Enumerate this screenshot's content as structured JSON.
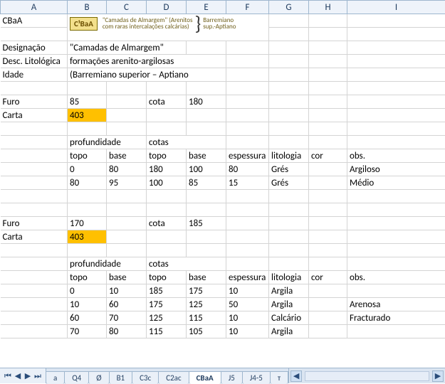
{
  "columns": [
    "A",
    "B",
    "C",
    "D",
    "E",
    "F",
    "G",
    "H",
    "I"
  ],
  "header": {
    "code": "CBaA",
    "legend_code": "C¹BaA",
    "legend_line1": "\"Camadas de Almargem\" (Arenitos",
    "legend_line2": "com raras intercalações calcárias)",
    "legend_age1": "Barremiano",
    "legend_age2": "sup.-Aptiano"
  },
  "labels": {
    "designacao": "Designação",
    "desc_lit": "Desc. Litológica",
    "idade": "Idade",
    "furo": "Furo",
    "carta": "Carta",
    "cota": "cota",
    "profundidade": "profundidade",
    "cotas": "cotas",
    "topo": "topo",
    "base": "base",
    "espessura": "espessura",
    "litologia": "litologia",
    "cor": "cor",
    "obs": "obs."
  },
  "meta": {
    "designacao": "\"Camadas de Almargem\"",
    "desc_lit": "formações arenito-argilosas",
    "idade": "(Barremiano superior – Aptiano"
  },
  "section1": {
    "furo": 85,
    "carta": 403,
    "cota": 180,
    "rows": [
      {
        "topo": 0,
        "base": 80,
        "c_topo": 180,
        "c_base": 100,
        "esp": 80,
        "lit": "Grés",
        "cor": "",
        "obs": "Argiloso"
      },
      {
        "topo": 80,
        "base": 95,
        "c_topo": 100,
        "c_base": 85,
        "esp": 15,
        "lit": "Grés",
        "cor": "",
        "obs": "Médio"
      }
    ]
  },
  "section2": {
    "furo": 170,
    "carta": 403,
    "cota": 185,
    "rows": [
      {
        "topo": 0,
        "base": 10,
        "c_topo": 185,
        "c_base": 175,
        "esp": 10,
        "lit": "Argila",
        "cor": "",
        "obs": ""
      },
      {
        "topo": 10,
        "base": 60,
        "c_topo": 175,
        "c_base": 125,
        "esp": 50,
        "lit": "Argila",
        "cor": "",
        "obs": "Arenosa"
      },
      {
        "topo": 60,
        "base": 70,
        "c_topo": 125,
        "c_base": 115,
        "esp": 10,
        "lit": "Calcário",
        "cor": "",
        "obs": "Fracturado"
      },
      {
        "topo": 70,
        "base": 80,
        "c_topo": 115,
        "c_base": 105,
        "esp": 10,
        "lit": "Argila",
        "cor": "",
        "obs": ""
      }
    ]
  },
  "tabs": [
    "a",
    "Q4",
    "Ø",
    "B1",
    "C3c",
    "C2ac",
    "CBaA",
    "J5",
    "J4-5",
    "т"
  ],
  "active_tab": 6
}
